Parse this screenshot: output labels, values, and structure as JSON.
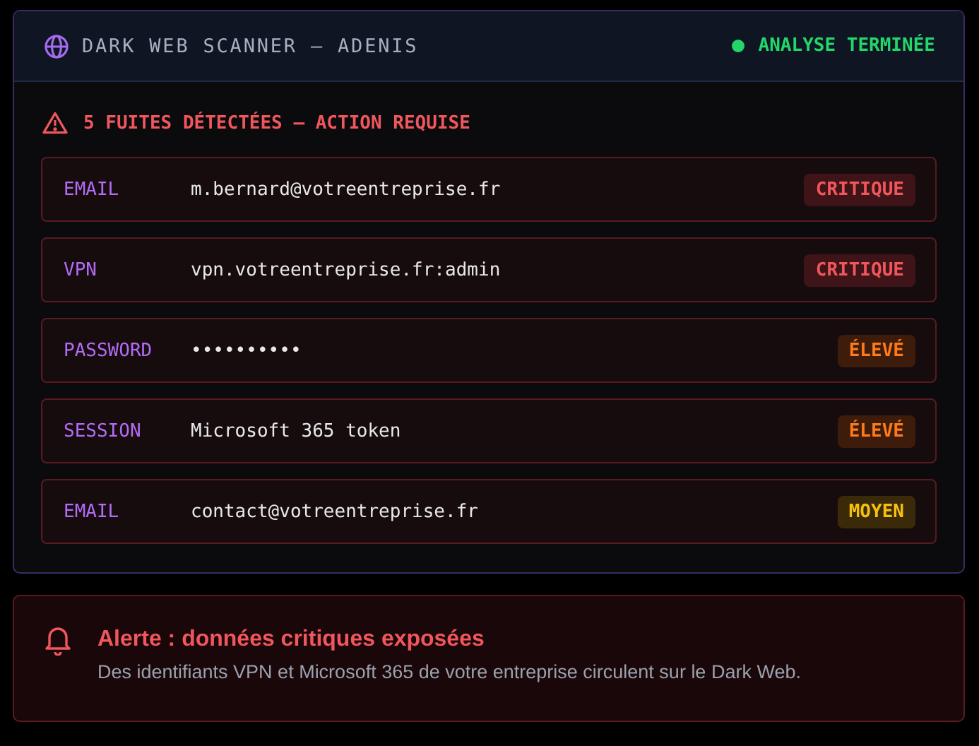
{
  "header": {
    "title": "DARK WEB SCANNER — ADENIS",
    "status": "ANALYSE TERMINÉE"
  },
  "warning": "5 FUITES DÉTECTÉES — ACTION REQUISE",
  "leaks": [
    {
      "type": "EMAIL",
      "value": "m.bernard@votreentreprise.fr",
      "severity": "CRITIQUE",
      "kind": "critical"
    },
    {
      "type": "VPN",
      "value": "vpn.votreentreprise.fr:admin",
      "severity": "CRITIQUE",
      "kind": "critical"
    },
    {
      "type": "PASSWORD",
      "value": "••••••••••",
      "severity": "ÉLEVÉ",
      "kind": "high"
    },
    {
      "type": "SESSION",
      "value": "Microsoft 365 token",
      "severity": "ÉLEVÉ",
      "kind": "high"
    },
    {
      "type": "EMAIL",
      "value": "contact@votreentreprise.fr",
      "severity": "MOYEN",
      "kind": "medium"
    }
  ],
  "alert": {
    "title": "Alerte : données critiques exposées",
    "text": "Des identifiants VPN et Microsoft 365 de votre entreprise circulent sur le Dark Web."
  }
}
